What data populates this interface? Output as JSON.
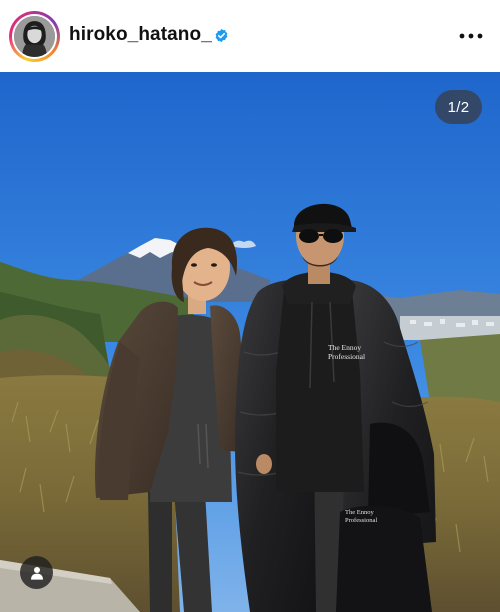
{
  "header": {
    "username": "hiroko_hatano_",
    "verified": true,
    "avatar_icon": "profile-avatar",
    "more_icon": "more-horizontal-icon"
  },
  "photo": {
    "counter": "1/2",
    "sweatshirt_print": "The Ennoy\nProfessional",
    "pants_print": "The Ennoy\nProfessional",
    "tagged_icon": "user-icon"
  },
  "colors": {
    "sky": "#2f78d8",
    "verified_badge": "#1d9bf0",
    "ring_accent": "#ee2a7b"
  }
}
